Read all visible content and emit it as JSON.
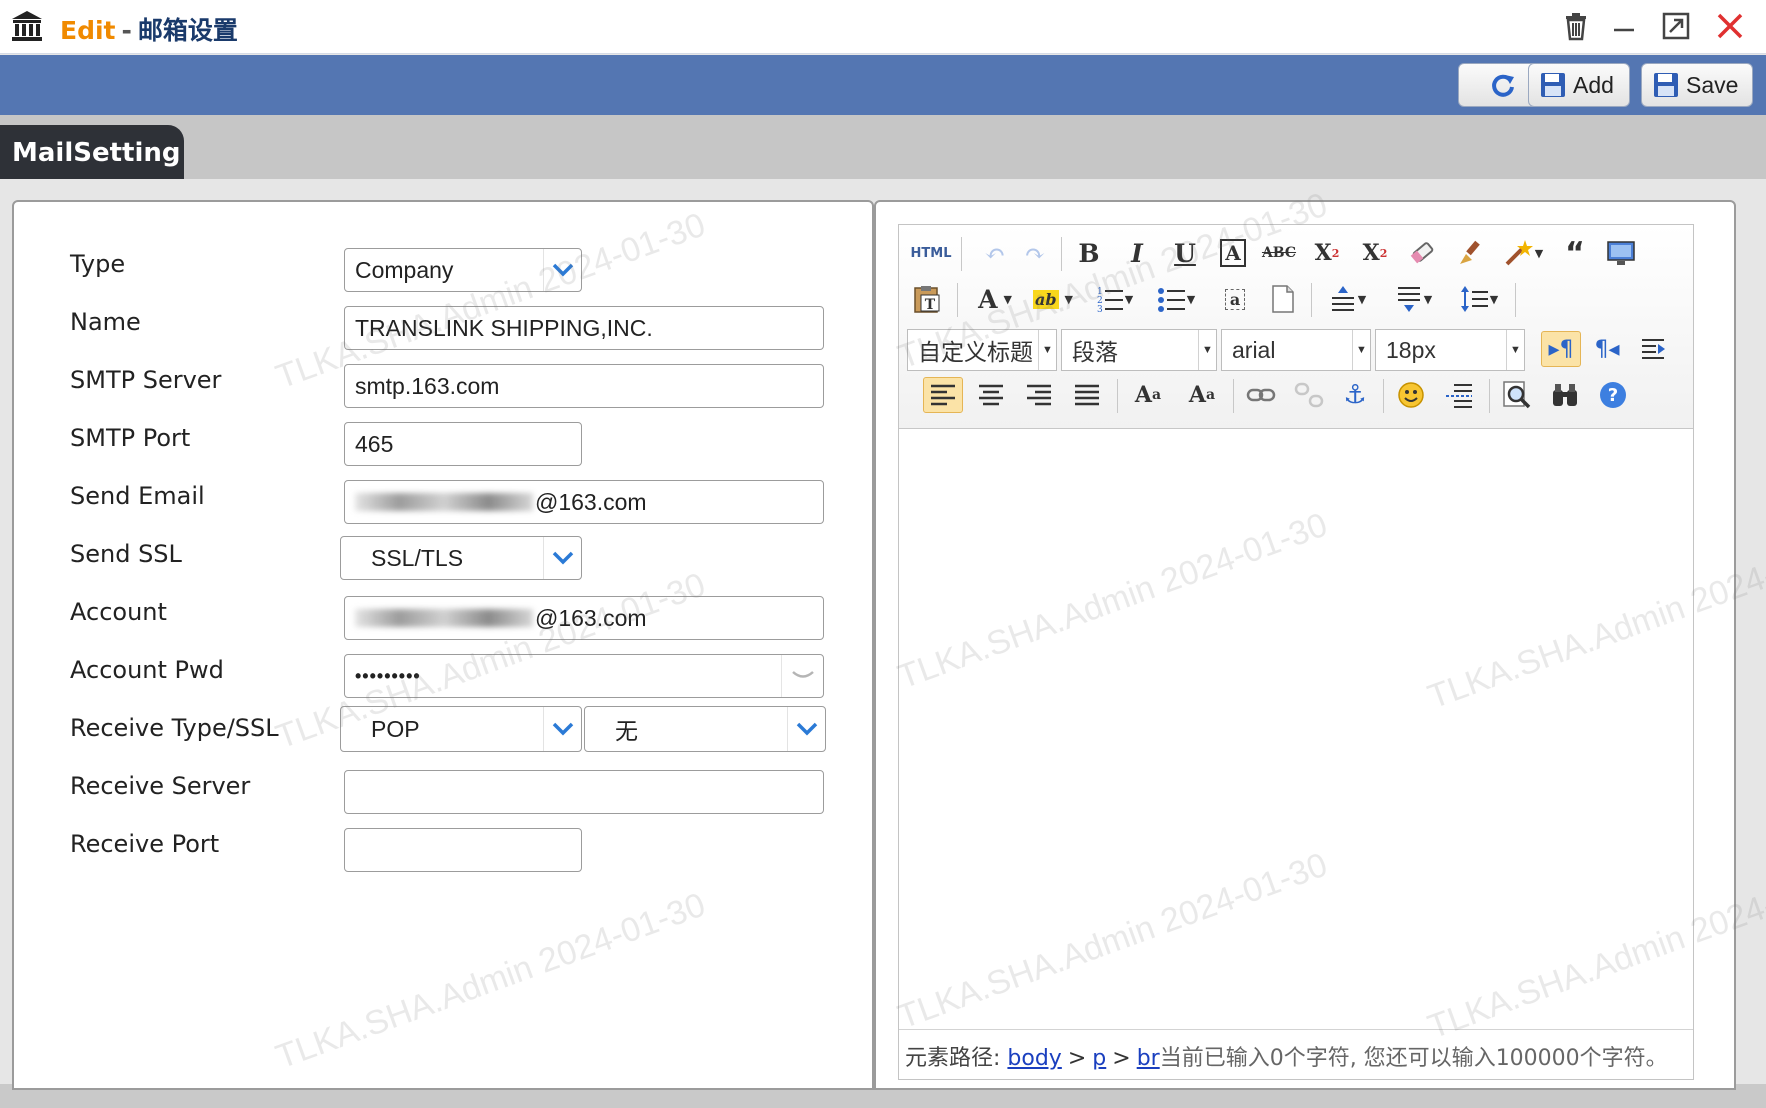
{
  "window": {
    "mode": "Edit",
    "separator": "-",
    "title": "邮箱设置"
  },
  "toolbar": {
    "add_label": "Add",
    "save_label": "Save"
  },
  "tab": {
    "label": "MailSetting"
  },
  "form": {
    "type": {
      "label": "Type",
      "value": "Company"
    },
    "name": {
      "label": "Name",
      "value": "TRANSLINK SHIPPING,INC."
    },
    "smtp_server": {
      "label": "SMTP Server",
      "value": "smtp.163.com"
    },
    "smtp_port": {
      "label": "SMTP Port",
      "value": "465"
    },
    "send_email": {
      "label": "Send Email",
      "value_visible": "@163.com"
    },
    "send_ssl": {
      "label": "Send SSL",
      "value": "SSL/TLS"
    },
    "account": {
      "label": "Account",
      "value_visible": "@163.com"
    },
    "account_pwd": {
      "label": "Account Pwd",
      "value": "•••••••••"
    },
    "receive_type_ssl": {
      "label": "Receive Type/SSL",
      "type_value": "POP",
      "ssl_value": "无"
    },
    "receive_server": {
      "label": "Receive Server",
      "value": ""
    },
    "receive_port": {
      "label": "Receive Port",
      "value": ""
    }
  },
  "editor": {
    "html_label": "HTML",
    "combos": {
      "heading": "自定义标题",
      "paragraph": "段落",
      "font": "arial",
      "size": "18px"
    },
    "status": {
      "path_label": "元素路径:",
      "path": [
        "body",
        "p",
        "br"
      ],
      "gt": ">",
      "count_text": "当前已输入0个字符, 您还可以输入100000个字符。"
    }
  },
  "watermark": "TLKA.SHA.Admin 2024-01-30",
  "colors": {
    "toolbar_bg": "#5476b2",
    "tab_bg": "#2e3137",
    "accent_edit": "#f08a00",
    "title_text": "#1a3a6b",
    "close_red": "#e03030",
    "link_blue": "#1a3fbf"
  }
}
